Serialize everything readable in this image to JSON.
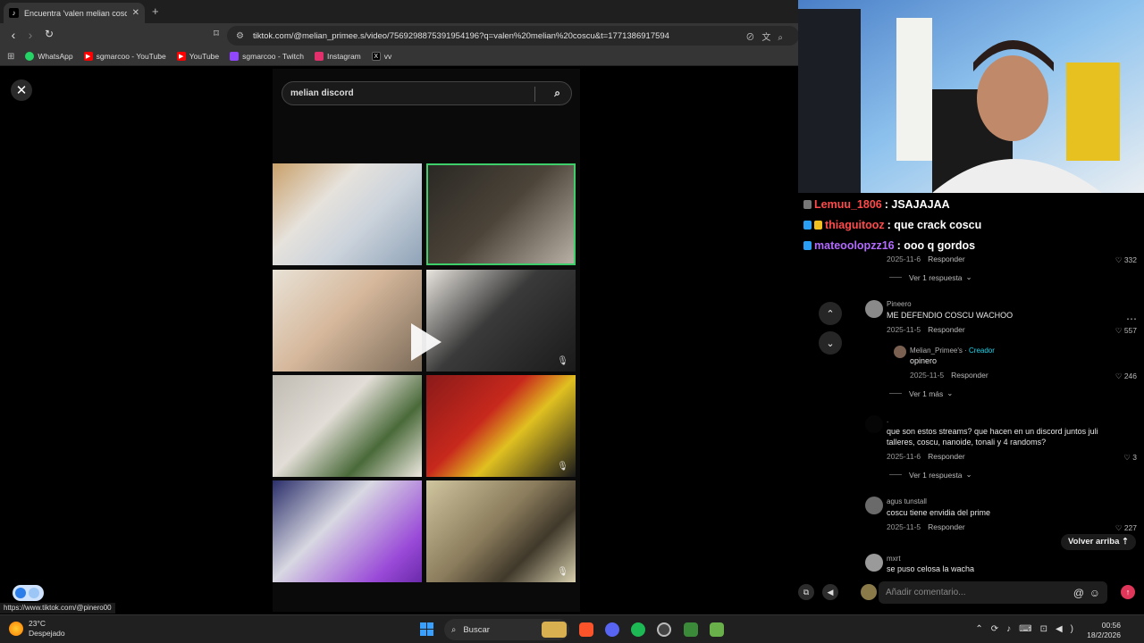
{
  "tab": {
    "title": "Encuentra 'valen melian coscu' e",
    "favicon": "tiktok-icon"
  },
  "address_bar": {
    "url": "tiktok.com/@melian_primee.s/video/7569298875391954196?q=valen%20melian%20coscu&t=1771386917594"
  },
  "bookmarks": [
    {
      "label": "WhatsApp",
      "color": "#25d366"
    },
    {
      "label": "sgmarcoo - YouTube",
      "color": "#ff0000"
    },
    {
      "label": "YouTube",
      "color": "#ff0000"
    },
    {
      "label": "sgmarcoo - Twitch",
      "color": "#9146ff"
    },
    {
      "label": "Instagram",
      "color": "#e1306c"
    },
    {
      "label": "vv",
      "color": "#000000"
    }
  ],
  "search": {
    "value": "melian discord"
  },
  "hover_url": "https://www.tiktok.com/@pinero00",
  "stream_chat": [
    {
      "user": "Lemuu_1806",
      "message": ": JSAJAJAA",
      "color": "#ff4b4b"
    },
    {
      "user": "thiaguitooz",
      "message": ": que crack coscu",
      "color": "#ff4b4b"
    },
    {
      "user": "mateoolopzz16",
      "message": ": ooo q gordos",
      "color": "#b36bff"
    }
  ],
  "comments": {
    "c0": {
      "date": "2025-11-6",
      "reply": "Responder",
      "likes": "332",
      "more": "Ver 1 respuesta"
    },
    "c1": {
      "user": "Pineero",
      "text": "ME DEFENDIO COSCU WACHOO",
      "date": "2025-11-5",
      "reply": "Responder",
      "likes": "557"
    },
    "c1r": {
      "user": "Melian_Primee's",
      "creator": "Creador",
      "text": "opinero",
      "date": "2025-11-5",
      "reply": "Responder",
      "likes": "246",
      "more": "Ver 1 más"
    },
    "c2": {
      "user": ".",
      "text": "que son estos streams? que hacen en un discord juntos juli talleres, coscu, nanoide, tonali y 4 randoms?",
      "date": "2025-11-6",
      "reply": "Responder",
      "likes": "3",
      "more": "Ver 1 respuesta"
    },
    "c3": {
      "user": "agus tunstall",
      "text": "coscu tiene envidia del prime",
      "date": "2025-11-5",
      "reply": "Responder",
      "likes": "227"
    },
    "c4": {
      "user": "mxrt",
      "text": "se puso celosa la wacha"
    }
  },
  "volver": "Volver arriba",
  "comment_input": {
    "placeholder": "Añadir comentario..."
  },
  "taskbar": {
    "temp": "23°C",
    "weather": "Despejado",
    "search": "Buscar",
    "time": "00:56",
    "date": "18/2/2026"
  }
}
